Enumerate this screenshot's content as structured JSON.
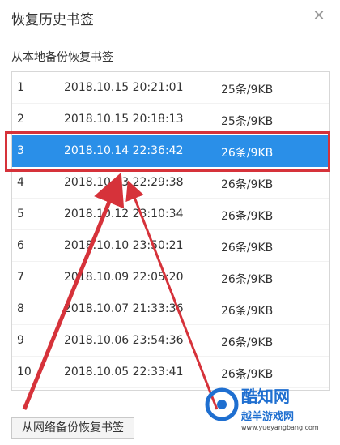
{
  "dialog": {
    "title": "恢复历史书签",
    "close_icon": "close-icon",
    "local_label": "从本地备份恢复书签",
    "network_button": "从网络备份恢复书签"
  },
  "backups": [
    {
      "index": "1",
      "datetime": "2018.10.15 20:21:01",
      "info": "25条/9KB"
    },
    {
      "index": "2",
      "datetime": "2018.10.15 20:18:13",
      "info": "25条/9KB"
    },
    {
      "index": "3",
      "datetime": "2018.10.14 22:36:42",
      "info": "26条/9KB"
    },
    {
      "index": "4",
      "datetime": "2018.10.13 22:29:38",
      "info": "26条/9KB"
    },
    {
      "index": "5",
      "datetime": "2018.10.12 23:10:34",
      "info": "26条/9KB"
    },
    {
      "index": "6",
      "datetime": "2018.10.10 23:50:21",
      "info": "26条/9KB"
    },
    {
      "index": "7",
      "datetime": "2018.10.09 22:05:20",
      "info": "26条/9KB"
    },
    {
      "index": "8",
      "datetime": "2018.10.07 21:33:36",
      "info": "26条/9KB"
    },
    {
      "index": "9",
      "datetime": "2018.10.06 23:54:36",
      "info": "26条/9KB"
    },
    {
      "index": "10",
      "datetime": "2018.10.05 22:33:41",
      "info": "26条/9KB"
    }
  ],
  "selected_index": "3",
  "watermark": {
    "name": "酷知网",
    "site": "越羊游戏网",
    "url": "www.yueyangbang.com"
  },
  "colors": {
    "selection": "#2a8fe8",
    "highlight": "#d6323a",
    "watermark": "#1f6fd0"
  }
}
